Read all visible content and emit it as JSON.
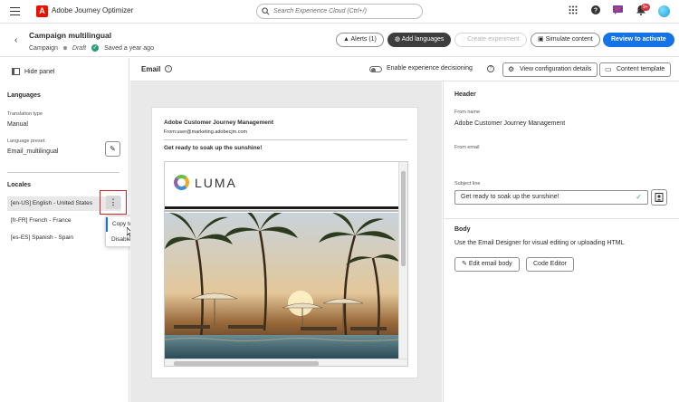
{
  "app": {
    "name": "Adobe Journey Optimizer",
    "logo_letter": "A",
    "search_placeholder": "Search Experience Cloud (Ctrl+/)",
    "notification_count": "9+"
  },
  "header": {
    "title": "Campaign multilingual",
    "type": "Campaign",
    "status": "Draft",
    "saved": "Saved a year ago",
    "buttons": {
      "alerts": "Alerts (1)",
      "add_languages": "Add languages",
      "create_experiment": "Create experiment",
      "simulate": "Simulate content",
      "review": "Review to activate"
    }
  },
  "left": {
    "hide_panel": "Hide panel",
    "languages_title": "Languages",
    "translation_type_label": "Translation type",
    "translation_type_value": "Manual",
    "language_preset_label": "Language preset",
    "language_preset_value": "Email_multilingual",
    "locales_title": "Locales",
    "locales": [
      "[en-US] English - United States",
      "[fr-FR] French - France",
      "[es-ES] Spanish - Spain"
    ],
    "kebab_glyph": "⋮",
    "menu": [
      "Copy to other locales",
      "Disable locale"
    ]
  },
  "content": {
    "title": "Email",
    "experience_decisioning": "Enable experience decisioning",
    "view_config": "View configuration details",
    "content_template": "Content template",
    "preview": {
      "from_name": "Adobe Customer Journey Management",
      "from_line": "From:user@marketing.adobecjm.com",
      "subject": "Get ready to soak up the sunshine!",
      "brand": "LUMA"
    }
  },
  "right": {
    "header_title": "Header",
    "from_name_label": "From name",
    "from_name_value": "Adobe Customer Journey Management",
    "from_email_label": "From email",
    "subject_label": "Subject line",
    "subject_value": "Get ready to soak up the sunshine!",
    "body_title": "Body",
    "body_desc": "Use the Email Designer for visual editing or uploading HTML",
    "edit_body": "Edit email body",
    "code_editor": "Code Editor"
  },
  "colors": {
    "accent": "#1473e6",
    "brand": "#eb1000",
    "success": "#2d9d78",
    "highlight_border": "#c9252d"
  }
}
